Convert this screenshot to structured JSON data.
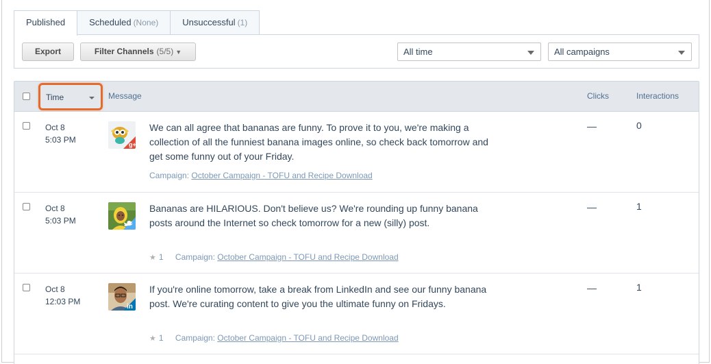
{
  "tabs": [
    {
      "label": "Published",
      "count": ""
    },
    {
      "label": "Scheduled",
      "count": "(None)"
    },
    {
      "label": "Unsuccessful",
      "count": "(1)"
    }
  ],
  "toolbar": {
    "export_label": "Export",
    "filter_label": "Filter Channels",
    "filter_count": "(5/5)",
    "time_select": "All time",
    "campaign_select": "All campaigns"
  },
  "table": {
    "headers": {
      "time": "Time",
      "message": "Message",
      "clicks": "Clicks",
      "interactions": "Interactions"
    },
    "rows": [
      {
        "date": "Oct 8",
        "time": "5:03 PM",
        "network": "google-plus",
        "message": "We can all agree that bananas are funny. To prove it to you, we're making a collection of all the funniest banana images online, so check back tomorrow and get some funny out of your Friday.",
        "favorites": "",
        "campaign_prefix": "Campaign:",
        "campaign": "October Campaign - TOFU and Recipe Download",
        "clicks": "—",
        "interactions": "0"
      },
      {
        "date": "Oct 8",
        "time": "5:03 PM",
        "network": "twitter",
        "message": "Bananas are HILARIOUS. Don't believe us? We're rounding up funny banana posts around the Internet so check tomorrow for a new (silly) post.",
        "favorites": "1",
        "campaign_prefix": "Campaign:",
        "campaign": "October Campaign - TOFU and Recipe Download",
        "clicks": "—",
        "interactions": "1"
      },
      {
        "date": "Oct 8",
        "time": "12:03 PM",
        "network": "linkedin",
        "message": "If you're online tomorrow, take a break from LinkedIn and see our funny banana post. We're curating content to give you the ultimate funny on Fridays.",
        "favorites": "1",
        "campaign_prefix": "Campaign:",
        "campaign": "October Campaign - TOFU and Recipe Download",
        "clicks": "—",
        "interactions": "1"
      }
    ]
  },
  "colors": {
    "highlight": "#e56b2c",
    "header_bg": "#e4e8ec",
    "google_plus": "#dd4b39",
    "twitter": "#55acee",
    "linkedin": "#0077b5"
  }
}
